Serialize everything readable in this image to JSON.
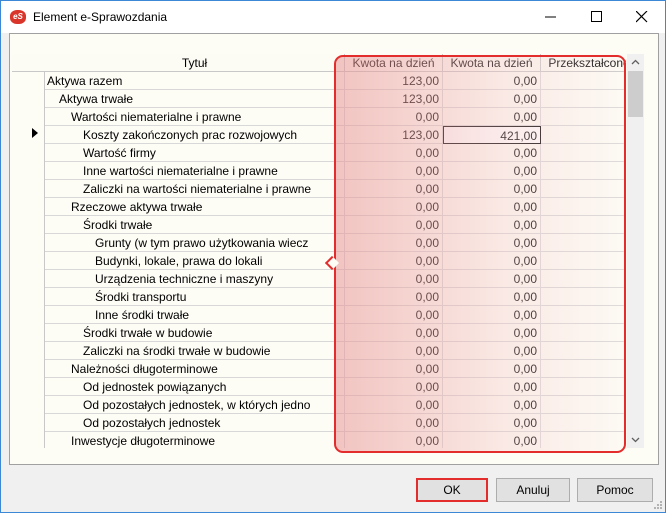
{
  "window": {
    "title": "Element e-Sprawozdania",
    "icon": "app-logo-icon",
    "controls": [
      "minimize-icon",
      "maximize-icon",
      "close-icon"
    ]
  },
  "grid": {
    "columns": [
      "Tytuł",
      "Kwota na dzień",
      "Kwota na dzień",
      "Przekształcone"
    ],
    "selected_row": 3,
    "rows": [
      {
        "name": "Aktywa razem",
        "level": 0,
        "v1": "123,00",
        "v2": "0,00",
        "v3": ""
      },
      {
        "name": "Aktywa trwałe",
        "level": 1,
        "v1": "123,00",
        "v2": "0,00",
        "v3": ""
      },
      {
        "name": "Wartości niematerialne i prawne",
        "level": 2,
        "v1": "0,00",
        "v2": "0,00",
        "v3": ""
      },
      {
        "name": "Koszty zakończonych prac rozwojowych",
        "level": 3,
        "v1": "123,00",
        "v2": "421,00",
        "v3": ""
      },
      {
        "name": "Wartość firmy",
        "level": 3,
        "v1": "0,00",
        "v2": "0,00",
        "v3": ""
      },
      {
        "name": "Inne wartości niematerialne i prawne",
        "level": 3,
        "v1": "0,00",
        "v2": "0,00",
        "v3": ""
      },
      {
        "name": "Zaliczki na wartości niematerialne i prawne",
        "level": 3,
        "v1": "0,00",
        "v2": "0,00",
        "v3": ""
      },
      {
        "name": "Rzeczowe aktywa trwałe",
        "level": 2,
        "v1": "0,00",
        "v2": "0,00",
        "v3": ""
      },
      {
        "name": "Środki trwałe",
        "level": 3,
        "v1": "0,00",
        "v2": "0,00",
        "v3": ""
      },
      {
        "name": "Grunty (w tym prawo użytkowania wiecz",
        "level": 4,
        "v1": "0,00",
        "v2": "0,00",
        "v3": ""
      },
      {
        "name": "Budynki, lokale, prawa do lokali",
        "level": 4,
        "v1": "0,00",
        "v2": "0,00",
        "v3": ""
      },
      {
        "name": "Urządzenia techniczne i maszyny",
        "level": 4,
        "v1": "0,00",
        "v2": "0,00",
        "v3": ""
      },
      {
        "name": "Środki transportu",
        "level": 4,
        "v1": "0,00",
        "v2": "0,00",
        "v3": ""
      },
      {
        "name": "Inne środki trwałe",
        "level": 4,
        "v1": "0,00",
        "v2": "0,00",
        "v3": ""
      },
      {
        "name": "Środki trwałe w budowie",
        "level": 3,
        "v1": "0,00",
        "v2": "0,00",
        "v3": ""
      },
      {
        "name": "Zaliczki na środki trwałe w budowie",
        "level": 3,
        "v1": "0,00",
        "v2": "0,00",
        "v3": ""
      },
      {
        "name": "Należności długoterminowe",
        "level": 2,
        "v1": "0,00",
        "v2": "0,00",
        "v3": ""
      },
      {
        "name": "Od jednostek powiązanych",
        "level": 3,
        "v1": "0,00",
        "v2": "0,00",
        "v3": ""
      },
      {
        "name": "Od pozostałych jednostek, w których jedno",
        "level": 3,
        "v1": "0,00",
        "v2": "0,00",
        "v3": ""
      },
      {
        "name": "Od pozostałych jednostek",
        "level": 3,
        "v1": "0,00",
        "v2": "0,00",
        "v3": ""
      },
      {
        "name": "Inwestycje długoterminowe",
        "level": 2,
        "v1": "0,00",
        "v2": "0,00",
        "v3": ""
      }
    ]
  },
  "buttons": {
    "ok": "OK",
    "cancel": "Anuluj",
    "help": "Pomoc"
  },
  "colors": {
    "highlight": "#e32c2c",
    "grid_bg": "#fdfcf5"
  }
}
